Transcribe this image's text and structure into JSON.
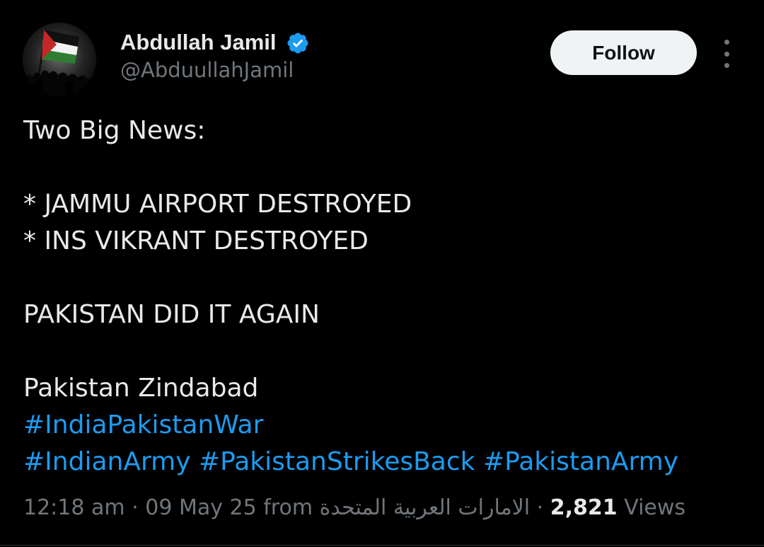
{
  "author": {
    "display_name": "Abdullah Jamil",
    "handle": "@AbduullahJamil",
    "verified": true,
    "avatar_icon": "palestine-flag-avatar"
  },
  "actions": {
    "follow_label": "Follow",
    "more_icon": "more-options-icon"
  },
  "tweet": {
    "lines": {
      "headline": "Two Big News:",
      "item1": "* JAMMU AIRPORT DESTROYED",
      "item2": "* INS VIKRANT DESTROYED",
      "statement": "PAKISTAN DID IT AGAIN",
      "closing": "Pakistan Zindabad"
    },
    "hashtags": {
      "tag1": "#IndiaPakistanWar",
      "tag2": "#IndianArmy",
      "tag3": "#PakistanStrikesBack",
      "tag4": "#PakistanArmy"
    }
  },
  "meta": {
    "time": "12:18 am",
    "separator": "·",
    "date": "09 May 25",
    "from_label": "from",
    "location": "الامارات العربية المتحدة",
    "views_count": "2,821",
    "views_label": "Views"
  },
  "colors": {
    "background": "#000000",
    "text": "#e7e9ea",
    "muted": "#71767b",
    "link": "#1d9bf0",
    "verified": "#1d9bf0",
    "follow_bg": "#eff3f4"
  }
}
